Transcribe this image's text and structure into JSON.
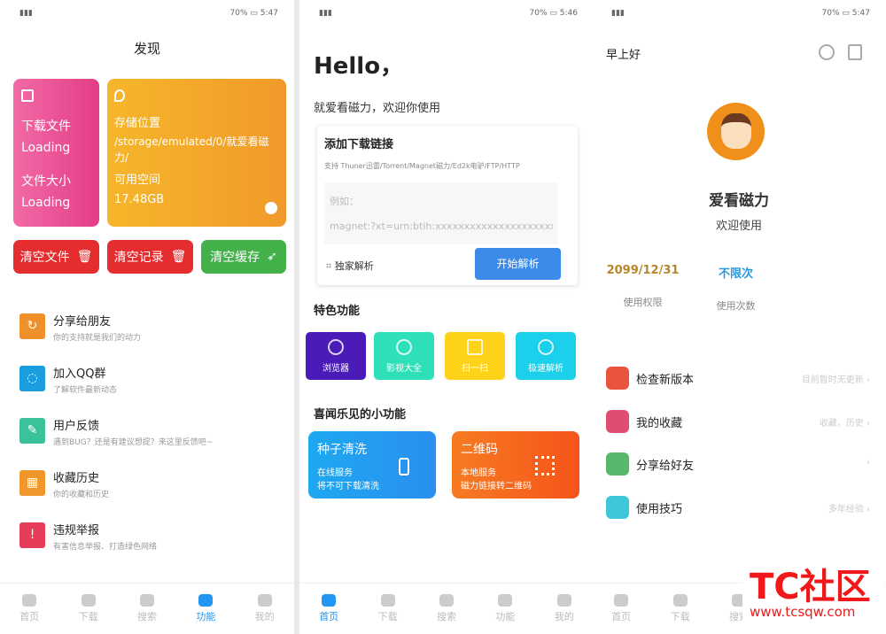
{
  "status": [
    {
      "battery": "70%",
      "time": "5:47"
    },
    {
      "battery": "70%",
      "time": "5:46"
    },
    {
      "battery": "70%",
      "time": "5:47"
    }
  ],
  "discover": {
    "title": "发现",
    "download_card": {
      "label1": "下载文件",
      "value1": "Loading",
      "label2": "文件大小",
      "value2": "Loading",
      "color": "#ec4f9b"
    },
    "storage_card": {
      "label1": "存储位置",
      "path": "/storage/emulated/0/就爱看磁力/",
      "label2": "可用空间",
      "free": "17.48GB",
      "color": "#f5a623"
    },
    "buttons": [
      {
        "label": "清空文件",
        "icon": "trash-icon"
      },
      {
        "label": "清空记录",
        "icon": "trash-icon"
      },
      {
        "label": "清空缓存",
        "icon": "rocket-icon"
      }
    ],
    "list": [
      {
        "title": "分享给朋友",
        "sub": "你的支持就是我们的动力",
        "color": "#f0902a"
      },
      {
        "title": "加入QQ群",
        "sub": "了解软件最新动态",
        "color": "#1a9ee0"
      },
      {
        "title": "用户反馈",
        "sub": "遇到BUG？还是有建议想提？来这里反馈吧~",
        "color": "#3cc29a"
      },
      {
        "title": "收藏历史",
        "sub": "你的收藏和历史",
        "color": "#f0962a"
      },
      {
        "title": "违规举报",
        "sub": "有害信息举报、打造绿色网络",
        "color": "#e63e5a"
      }
    ]
  },
  "home": {
    "hello": "Hello，",
    "welcome": "就爱看磁力，欢迎你使用",
    "add_title": "添加下载链接",
    "support": "支持 Thuner迅雷/Torrent/Magnet磁力/Ed2k电驴/FTP/HTTP",
    "placeholder1": "例如：",
    "placeholder2": "magnet:?xt=urn:btih:xxxxxxxxxxxxxxxxxxxxx",
    "exclusive": "独家解析",
    "start": "开始解析",
    "features_title": "特色功能",
    "features": [
      {
        "label": "浏览器",
        "color": "#4a1bb8"
      },
      {
        "label": "影视大全",
        "color": "#2ee0b8"
      },
      {
        "label": "扫一扫",
        "color": "#ffd21a"
      },
      {
        "label": "极速解析",
        "color": "#1ad0ea"
      }
    ],
    "mini_title": "喜闻乐见的小功能",
    "mini": [
      {
        "title": "种子清洗",
        "l1": "在线服务",
        "l2": "将不可下载清洗"
      },
      {
        "title": "二维码",
        "l1": "本地服务",
        "l2": "磁力链接转二维码"
      }
    ]
  },
  "profile": {
    "greeting": "早上好",
    "name": "爱看磁力",
    "welcome": "欢迎使用",
    "stats": [
      {
        "value": "2099/12/31",
        "label": "使用权限",
        "color": "#b8862a"
      },
      {
        "value": "不限次",
        "label": "使用次数",
        "color": "#2a9ad8"
      }
    ],
    "menu": [
      {
        "label": "检查新版本",
        "right": "目前暂时无更新",
        "color": "#e8543e"
      },
      {
        "label": "我的收藏",
        "right": "收藏，历史",
        "color": "#e04d72"
      },
      {
        "label": "分享给好友",
        "right": "",
        "color": "#55b86a"
      },
      {
        "label": "使用技巧",
        "right": "多年经验",
        "color": "#3cc8d8"
      }
    ]
  },
  "nav": [
    "首页",
    "下载",
    "搜索",
    "功能",
    "我的"
  ],
  "watermark": {
    "brand": "TC社区",
    "url": "www.tcsqw.com"
  }
}
